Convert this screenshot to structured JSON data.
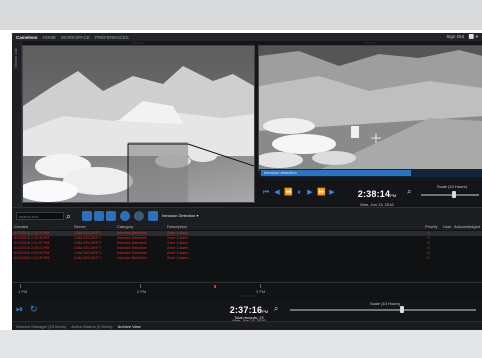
{
  "menubar": {
    "brand": "Cameleon",
    "items": [
      "HOME",
      "WORKSPACE",
      "PREFERENCES"
    ],
    "signout": "Sign Out",
    "window_controls": "⬜ ▾"
  },
  "sidebar": {
    "label": "Device List"
  },
  "timeline": {
    "segment_label": "Intrusion detection"
  },
  "playback": {
    "time": "2:38:14",
    "ampm": "PM",
    "date": "Mon, Jun 13, 2016",
    "scale_label": "Scale (10 Hours)",
    "scale_level": 0.55
  },
  "toolbar": {
    "search_placeholder": "search text",
    "filter_label": "Intrusion Detection",
    "filter_caret": "▾"
  },
  "grid": {
    "columns": [
      "Created",
      "Server",
      "Category",
      "Description",
      "Priority",
      "User",
      "Acknowledged"
    ],
    "rows": [
      {
        "created": "6/13/2016 2:38:14 PM",
        "server": "CAM-SECURITY",
        "category": "Intrusion Detection",
        "description": "Zone 1 Alarm",
        "priority": "H"
      },
      {
        "created": "6/13/2016 2:34:46 PM",
        "server": "CAM-SECURITY",
        "category": "Intrusion Detection",
        "description": "Zone 1 Alarm",
        "priority": "H"
      },
      {
        "created": "6/13/2016 2:31:57 PM",
        "server": "CAM-SECURITY",
        "category": "Intrusion Detection",
        "description": "Zone 1 Alarm",
        "priority": "H"
      },
      {
        "created": "6/13/2016 2:25:14 PM",
        "server": "CAM-SECURITY",
        "category": "Intrusion Detection",
        "description": "Zone 1 Alarm",
        "priority": "H"
      },
      {
        "created": "6/13/2016 2:19:05 PM",
        "server": "CAM-SECURITY",
        "category": "Intrusion Detection",
        "description": "Zone 1 Alarm",
        "priority": "H"
      },
      {
        "created": "6/13/2016 2:12:33 PM",
        "server": "CAM-SECURITY",
        "category": "Intrusion Detection",
        "description": "Zone 1 Alarm",
        "priority": "H"
      }
    ]
  },
  "timeline2": {
    "labels": [
      "1 PM",
      "2 PM",
      "3 PM"
    ]
  },
  "playback2": {
    "time": "2:37:16",
    "ampm": "PM",
    "date": "Mon, Jun 13, 2016",
    "scale_label": "Scale (10 Hours)",
    "scale_level": 0.6,
    "total_records": "Total records: 13"
  },
  "status": {
    "items": [
      "Session Manager (15 Items)",
      "Active Alarms (0 Items)",
      "Archive View"
    ]
  },
  "colors": {
    "accent": "#2d6fb8",
    "alarm": "#e0302b",
    "background": "#141518"
  }
}
